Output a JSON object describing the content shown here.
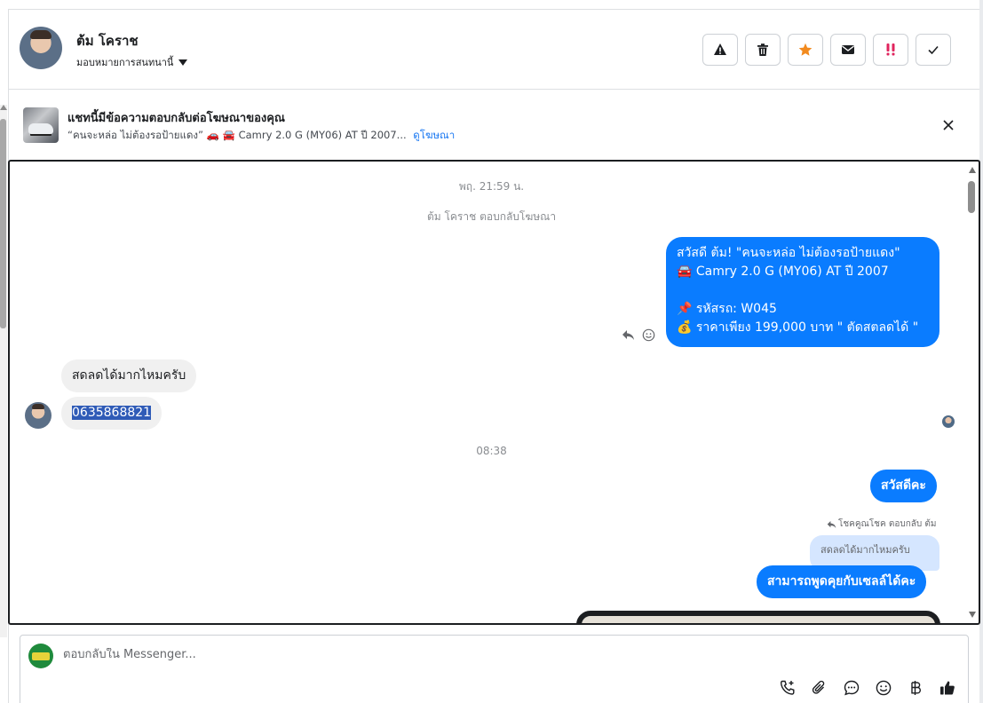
{
  "header": {
    "contact_name": "ต้ม โคราช",
    "assign_label": "มอบหมายการสนทนานี้"
  },
  "ad_banner": {
    "title": "แชทนี้มีข้อความตอบกลับต่อโฆษณาของคุณ",
    "subtitle": "“คนจะหล่อ ไม่ต้องรอป้ายแดง” 🚗 🚘 Camry 2.0 G (MY06) AT ปี 2007...",
    "link_label": "ดูโฆษณา"
  },
  "messages": {
    "timestamp_1": "พฤ. 21:59 น.",
    "event_1": "ต้ม โคราช ตอบกลับโฆษณา",
    "out_1": {
      "line1": "สวัสดี ต้ม! \"คนจะหล่อ ไม่ต้องรอป้ายแดง\"",
      "line2": "🚘 Camry 2.0 G (MY06) AT ปี 2007",
      "line3": "📌 รหัสรถ: W045",
      "line4": "💰 ราคาเพียง 199,000 บาท \" ตัดสตลดได้ \""
    },
    "in_1": "สดลดได้มากไหมครับ",
    "in_2": "0635868821",
    "timestamp_2": "08:38",
    "out_2": "สวัสดีคะ",
    "reply_note": "โชคคูณโชค ตอบกลับ ต้ม",
    "quoted": "สดลดได้มากไหมครับ",
    "out_3": "สามารถพูดคุยกับเซลล์ได้คะ"
  },
  "composer": {
    "placeholder": "ตอบกลับใน Messenger..."
  },
  "colors": {
    "accent": "#0a7cff",
    "incoming_bubble": "#f0f0f0",
    "star": "#f28a1e",
    "urgent": "#e0245e"
  },
  "icons": {
    "actions": [
      "warning-icon",
      "trash-icon",
      "star-icon",
      "envelope-icon",
      "exclamation-icon",
      "check-icon"
    ],
    "tools": [
      "call-add-icon",
      "paperclip-icon",
      "chat-bubble-icon",
      "smiley-icon",
      "baht-icon",
      "thumbs-up-icon"
    ]
  }
}
